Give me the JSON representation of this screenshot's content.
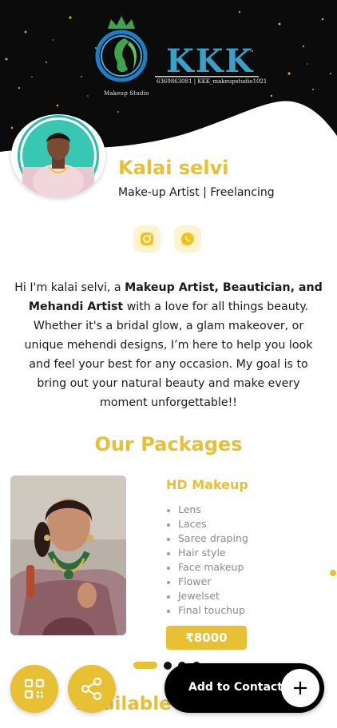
{
  "brand": {
    "name": "KKK",
    "caption": "Makeup Studio",
    "contact_line": "6369863081  |  KKK_makeupstudio1021"
  },
  "profile": {
    "name": "Kalai selvi",
    "role": "Make-up Artist | Freelancing"
  },
  "social": [
    {
      "name": "instagram",
      "icon": "instagram-icon"
    },
    {
      "name": "whatsapp",
      "icon": "whatsapp-icon"
    }
  ],
  "bio": {
    "intro": "Hi I'm kalai selvi, a ",
    "highlight": "Makeup Artist, Beautician, and Mehandi Artist",
    "rest": " with a love for all things beauty. Whether it's a bridal glow, a glam makeover, or unique mehendi designs, I’m here to help you look and feel your best for any occasion. My goal is to bring out your natural beauty and make every moment unforgettable!!"
  },
  "packages": {
    "title": "Our Packages",
    "current": {
      "name": "HD Makeup",
      "items": [
        "Lens",
        "Laces",
        "Saree draping",
        "Hair style",
        "Face makeup",
        "Flower",
        "Jewelset",
        "Final touchup"
      ],
      "price": "₹8000"
    },
    "carousel": {
      "active_index": 0,
      "count": 4
    }
  },
  "next_section_title": "Available",
  "actions": {
    "qr_icon": "qr-code-icon",
    "share_icon": "share-icon",
    "add_contact_label": "Add to Contact"
  },
  "colors": {
    "accent": "#e8c034",
    "dark": "#0b0b0b",
    "social_bg": "#fdf4cf"
  }
}
